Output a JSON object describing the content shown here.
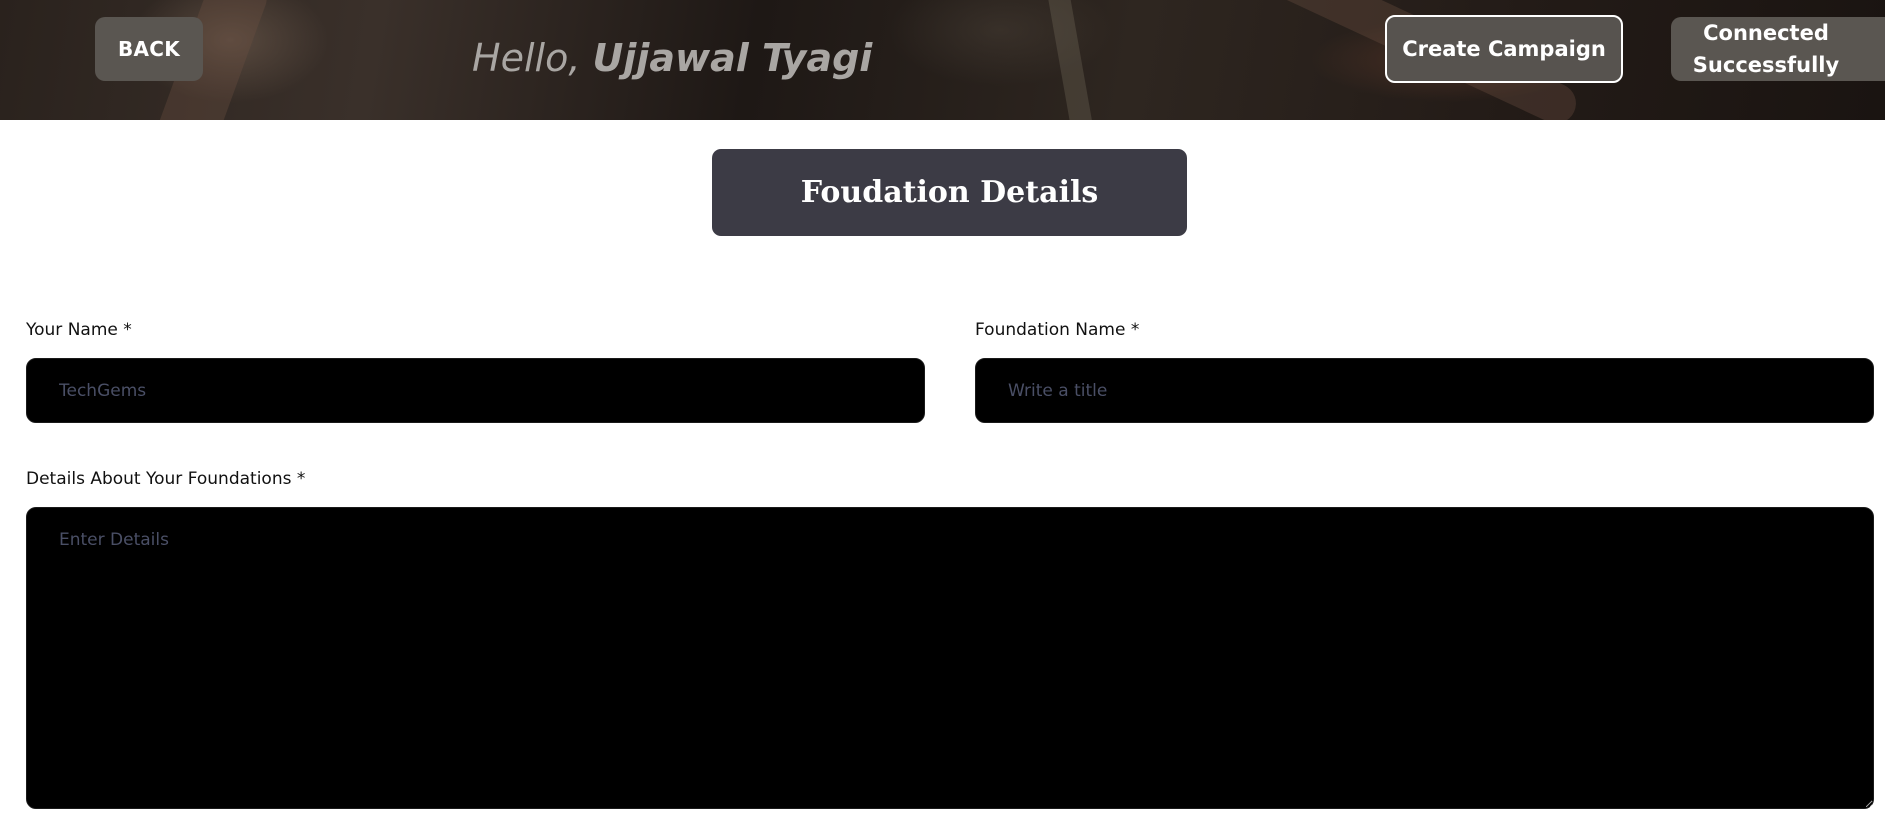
{
  "header": {
    "back_label": "BACK",
    "greeting_prefix": "Hello, ",
    "user_name": "Ujjawal Tyagi",
    "create_label": "Create Campaign",
    "connected_line1": "Connected",
    "connected_line2": "Successfully"
  },
  "page": {
    "title": "Foudation Details"
  },
  "form": {
    "your_name": {
      "label": "Your Name *",
      "placeholder": "TechGems",
      "value": ""
    },
    "foundation_name": {
      "label": "Foundation Name *",
      "placeholder": "Write a title",
      "value": ""
    },
    "details": {
      "label": "Details About Your Foundations *",
      "placeholder": "Enter Details",
      "value": ""
    }
  },
  "colors": {
    "button_bg": "#5a5651",
    "title_bg": "#3c3b45",
    "input_bg": "#000000",
    "placeholder": "#4a4f66"
  }
}
